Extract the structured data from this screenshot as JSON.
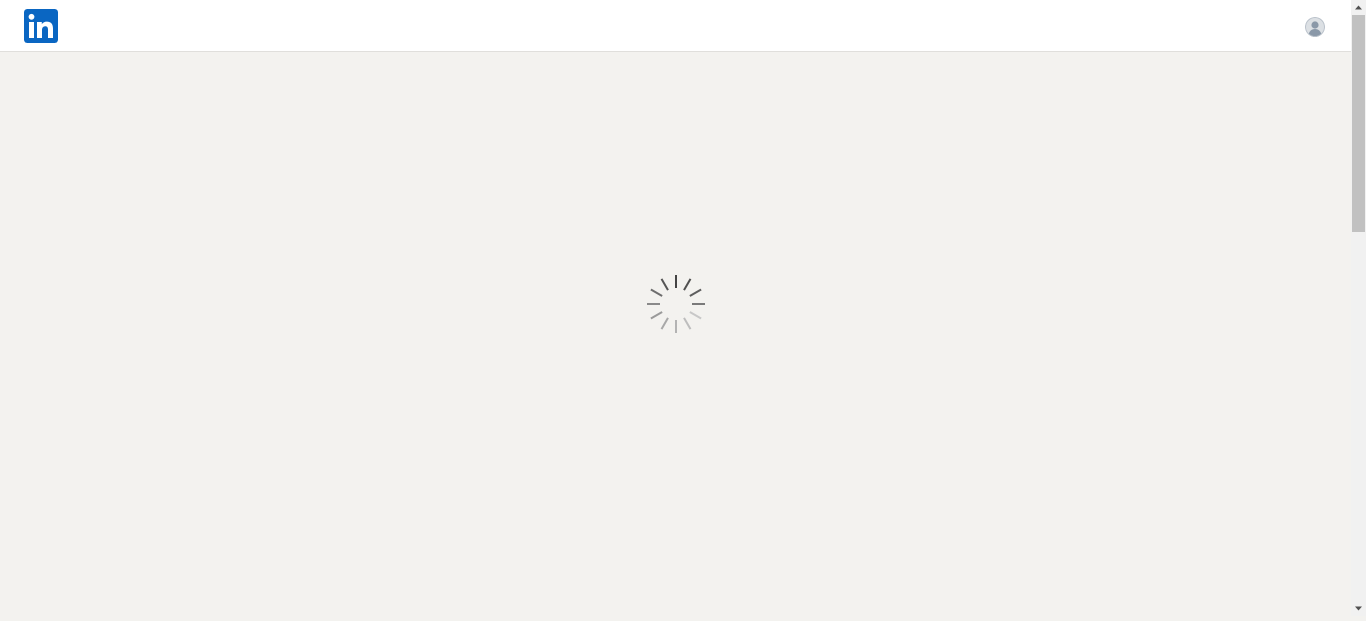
{
  "header": {
    "logo_icon": "linkedin-logo-icon",
    "logo_text": "in",
    "brand_color": "#0a66c2",
    "avatar_icon": "user-avatar-icon"
  },
  "main": {
    "state": "loading",
    "spinner_icon": "loading-spinner-icon"
  },
  "colors": {
    "page_background": "#f3f2ef",
    "header_background": "#ffffff",
    "spinner": "#666666"
  }
}
